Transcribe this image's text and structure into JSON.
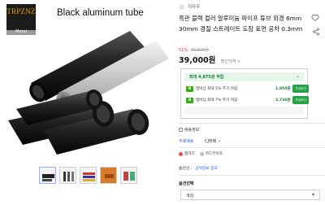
{
  "image": {
    "brand_name": "TRPZNZ",
    "brand_subtitle": "Metal",
    "title": "Black aluminum tube"
  },
  "thumbnails": [
    {
      "name": "thumb-black-tubes"
    },
    {
      "name": "thumb-tube-set"
    },
    {
      "name": "thumb-colored-tubes"
    },
    {
      "name": "thumb-orange-tube"
    },
    {
      "name": "thumb-mixed-tubes"
    }
  ],
  "product": {
    "seller": "지마우",
    "title": "흑관 블랙 컬러 알루미늄 파이프 튜브 외경 6mm 30mm 경질 스트레이트 도장 표면 공차 0.3mm",
    "discount_pct": "51%",
    "original_price": "79,600원",
    "price": "39,000원",
    "price_detail": "할인가격 >"
  },
  "benefits": {
    "header": "최대 4,875원 적립",
    "rows": [
      {
        "badge": "N",
        "text": "멤버십 최대 5% 추가 적립",
        "points": "1,950원",
        "button": "가입하기"
      },
      {
        "badge": "N",
        "text": "멤버십 최대 7% 추가 적립",
        "points": "2,730원",
        "button": "가입하기"
      }
    ]
  },
  "shipping": {
    "label": "배송정보",
    "free": "무료배송",
    "courier": "CJ택배",
    "chevron": "▾"
  },
  "options_row": {
    "a": "찜하기",
    "b": "카드무이자"
  },
  "payment": {
    "label": "옵션선 :",
    "value": "상세정보 참조"
  },
  "option": {
    "title": "옵션선택",
    "select_value": "색상",
    "caret": "▾"
  },
  "colors": {
    "accent_red": "#ff2d2d",
    "benefit_green": "#25a244",
    "link_blue": "#2f66ff"
  }
}
